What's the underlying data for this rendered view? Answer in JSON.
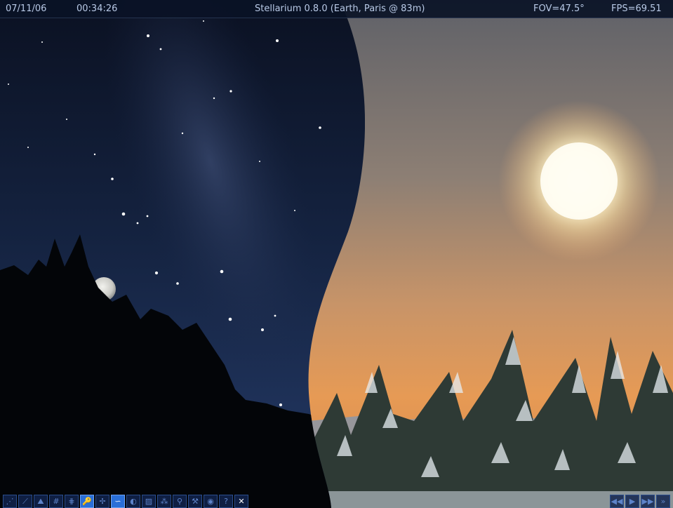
{
  "top_bar": {
    "date": "07/11/06",
    "time": "00:34:26",
    "title": "Stellarium 0.8.0 (Earth, Paris @ 83m)",
    "fov": "FOV=47.5°",
    "fps": "FPS=69.51"
  },
  "toolbar": {
    "buttons": [
      {
        "icon": "constellation-lines-icon",
        "glyph": "⋰"
      },
      {
        "icon": "constellation-art-icon",
        "glyph": "⟋"
      },
      {
        "icon": "constellation-names-icon",
        "glyph": "⛰"
      },
      {
        "icon": "azimuth-grid-icon",
        "glyph": "#"
      },
      {
        "icon": "equatorial-grid-icon",
        "glyph": "⋕"
      },
      {
        "icon": "ground-icon",
        "glyph": "🔑",
        "active": true
      },
      {
        "icon": "cardinal-points-icon",
        "glyph": "✢"
      },
      {
        "icon": "atmosphere-icon",
        "glyph": "∽",
        "active": true
      },
      {
        "icon": "nebulas-icon",
        "glyph": "◐"
      },
      {
        "icon": "planets-icon",
        "glyph": "▨"
      },
      {
        "icon": "equatorial-mount-icon",
        "glyph": "⁂"
      },
      {
        "icon": "search-icon",
        "glyph": "⚲"
      },
      {
        "icon": "configuration-icon",
        "glyph": "⚒"
      },
      {
        "icon": "night-mode-icon",
        "glyph": "◉"
      },
      {
        "icon": "help-icon",
        "glyph": "?"
      },
      {
        "icon": "quit-icon",
        "glyph": "✕",
        "bright": true
      }
    ]
  },
  "time_controls": [
    {
      "icon": "rewind-icon",
      "glyph": "◀◀"
    },
    {
      "icon": "play-icon",
      "glyph": "▶"
    },
    {
      "icon": "fast-forward-icon",
      "glyph": "▶▶"
    },
    {
      "icon": "real-time-icon",
      "glyph": "»"
    }
  ],
  "colors": {
    "night_sky": "#0c1830",
    "day_sky_top": "#6b6a6c",
    "day_horizon": "#e59a56",
    "sun": "#fff6d8",
    "toolbar_active": "#2a6fd8"
  }
}
